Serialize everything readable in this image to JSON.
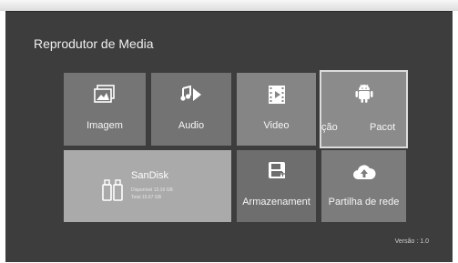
{
  "app": {
    "title": "Reprodutor de Media",
    "version": "Versão : 1.0"
  },
  "tiles": {
    "image": {
      "label": "Imagem",
      "icon": "image-icon"
    },
    "audio": {
      "label": "Audio",
      "icon": "music-icon"
    },
    "video": {
      "label": "Video",
      "icon": "film-icon"
    },
    "app": {
      "label_left": "ção",
      "label_right": "Pacot",
      "icon": "android-icon"
    },
    "storage": {
      "label": "Armazenament",
      "icon": "storage-icon"
    },
    "network": {
      "label": "Partilha de rede",
      "icon": "cloud-icon"
    }
  },
  "device": {
    "name": "SanDisk",
    "available": "Disponível 13.16 GB",
    "total": "Total 15.67 GB",
    "icon": "usb-drive-icon"
  },
  "colors": {
    "background": "#3d3d3d",
    "tile": "#7a7a7a",
    "selected_border": "#dcdcdc"
  }
}
